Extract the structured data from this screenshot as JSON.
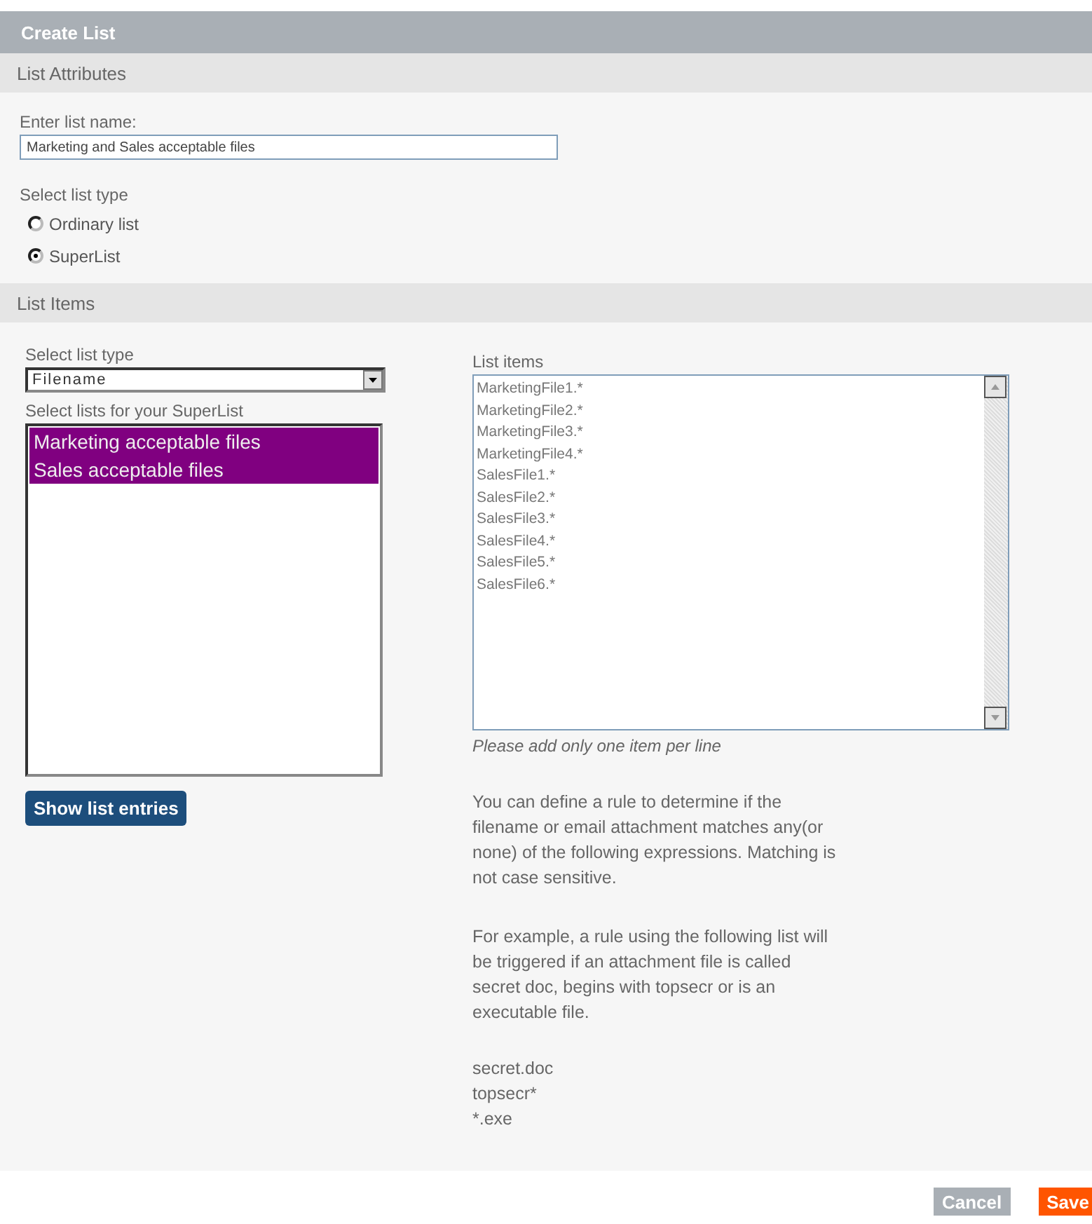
{
  "window": {
    "title": "Create List"
  },
  "attributes": {
    "header": "List Attributes",
    "name_label": "Enter list name:",
    "name_value": "Marketing and Sales acceptable files",
    "type_label": "Select list type",
    "type_options": [
      {
        "label": "Ordinary list",
        "selected": false
      },
      {
        "label": "SuperList",
        "selected": true
      }
    ]
  },
  "items_section": {
    "header": "List Items",
    "type_label": "Select list type",
    "type_value": "Filename",
    "lists_label": "Select lists for your SuperList",
    "lists": [
      {
        "label": "Marketing acceptable files",
        "selected": true
      },
      {
        "label": "Sales acceptable files",
        "selected": true
      }
    ],
    "show_button": "Show list entries",
    "items_label": "List items",
    "items": [
      "MarketingFile1.*",
      "MarketingFile2.*",
      "MarketingFile3.*",
      "MarketingFile4.*",
      "SalesFile1.*",
      "SalesFile2.*",
      "SalesFile3.*",
      "SalesFile4.*",
      "SalesFile5.*",
      "SalesFile6.*"
    ],
    "hint": "Please add only one item per line",
    "paragraphs": [
      "You can define a rule to determine if the filename or email attachment matches any(or none) of the following expressions. Matching is not case sensitive.",
      "For example, a rule using the following list will be triggered if an attachment file is called secret doc, begins with topsecr or is an executable file."
    ],
    "examples": [
      "secret.doc",
      "topsecr*",
      "*.exe"
    ]
  },
  "buttons": [
    "Cancel",
    "Save"
  ]
}
